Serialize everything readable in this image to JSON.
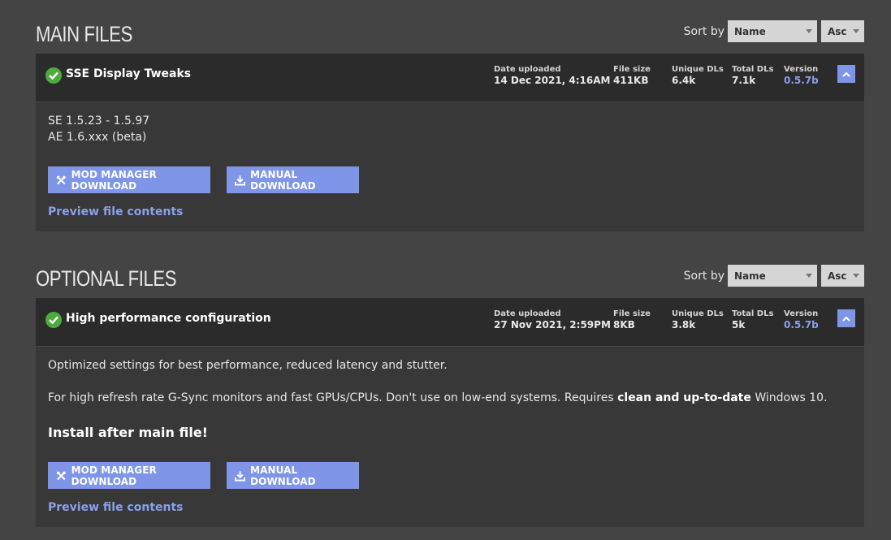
{
  "main": {
    "title": "MAIN FILES",
    "sort": {
      "label": "Sort by",
      "field": "Name",
      "direction": "Asc"
    },
    "file": {
      "name": "SSE Display Tweaks",
      "status_icon": "check-circle-icon",
      "stats": [
        {
          "key": "Date uploaded",
          "value": "14 Dec 2021, 4:16AM"
        },
        {
          "key": "File size",
          "value": "411KB"
        },
        {
          "key": "Unique DLs",
          "value": "6.4k"
        },
        {
          "key": "Total DLs",
          "value": "7.1k"
        },
        {
          "key": "Version",
          "value": "0.5.7b"
        }
      ],
      "desc_lines": [
        "SE 1.5.23 - 1.5.97",
        "AE 1.6.xxx (beta)"
      ],
      "mod_manager_label": "MOD MANAGER DOWNLOAD",
      "manual_label": "MANUAL DOWNLOAD",
      "preview_label": "Preview file contents"
    }
  },
  "optional": {
    "title": "OPTIONAL FILES",
    "sort": {
      "label": "Sort by",
      "field": "Name",
      "direction": "Asc"
    },
    "file": {
      "name": "High performance configuration",
      "status_icon": "check-circle-icon",
      "stats": [
        {
          "key": "Date uploaded",
          "value": "27 Nov 2021, 2:59PM"
        },
        {
          "key": "File size",
          "value": "8KB"
        },
        {
          "key": "Unique DLs",
          "value": "3.8k"
        },
        {
          "key": "Total DLs",
          "value": "5k"
        },
        {
          "key": "Version",
          "value": "0.5.7b"
        }
      ],
      "desc1": "Optimized settings for best performance, reduced latency and stutter.",
      "desc2_pre": "For high refresh rate G-Sync monitors and fast GPUs/CPUs. Don't use on low-end systems. Requires ",
      "desc2_bold": "clean and up-to-date",
      "desc2_post": " Windows 10.",
      "install_note": "Install after main file!",
      "mod_manager_label": "MOD MANAGER DOWNLOAD",
      "manual_label": "MANUAL DOWNLOAD",
      "preview_label": "Preview file contents"
    }
  },
  "colors": {
    "accent": "#7f96e8",
    "link": "#8ba0eb",
    "check": "#4faa3c",
    "background": "#444444",
    "card": "#383838",
    "card_header": "#2b2b2b"
  }
}
